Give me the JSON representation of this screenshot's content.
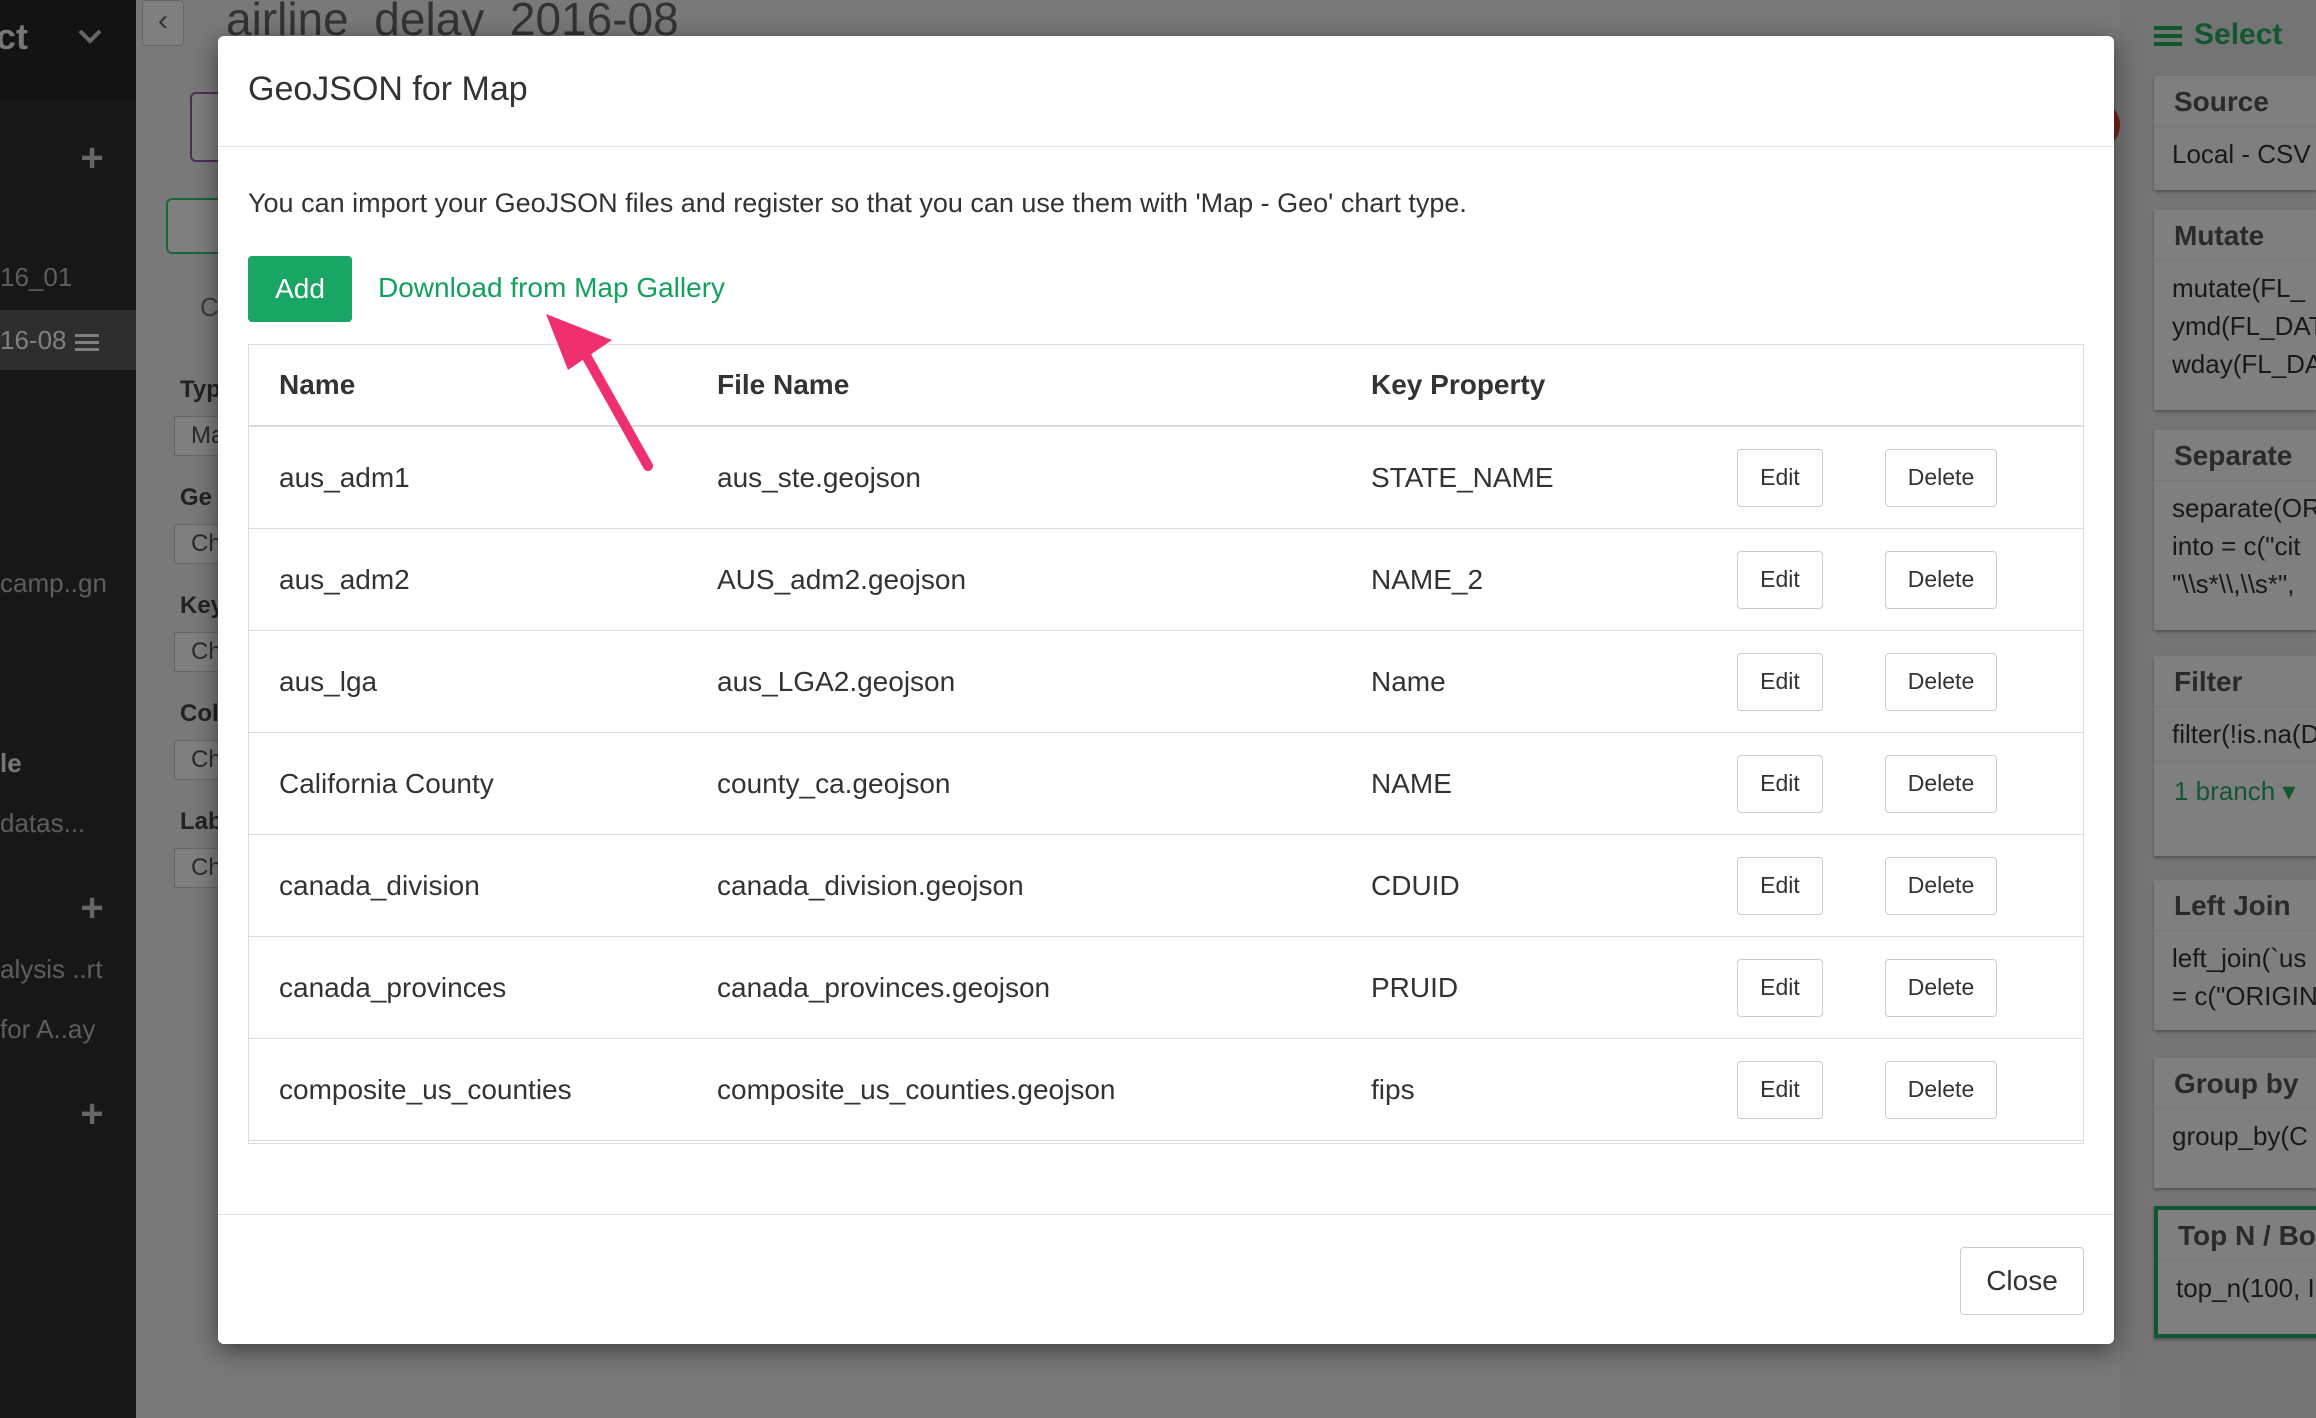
{
  "sidebar": {
    "project_title": "ct",
    "items": [
      {
        "label": "16_01"
      },
      {
        "label": "16-08"
      },
      {
        "label": "camp..gn"
      },
      {
        "label": "le"
      },
      {
        "label": "datas..."
      },
      {
        "label": "alysis ..rt"
      },
      {
        "label": "for A..ay"
      }
    ],
    "plus": "+"
  },
  "main": {
    "title": "airline_delay_2016-08",
    "back_glyph": "‹",
    "fields": [
      {
        "label": "Typ",
        "value": "Ma"
      },
      {
        "label": "Ge",
        "value": "Ch"
      },
      {
        "label": "Key",
        "value": "Ch"
      },
      {
        "label": "Col",
        "value": "Ch"
      },
      {
        "label": "Lab",
        "value": "Ch"
      }
    ],
    "tab_letter": "C"
  },
  "right_panel": {
    "select_label": "Select",
    "steps": [
      {
        "title": "Source",
        "body": [
          "Local - CSV"
        ]
      },
      {
        "title": "Mutate",
        "body": [
          "mutate(FL_",
          "ymd(FL_DAT",
          "wday(FL_DA"
        ]
      },
      {
        "title": "Separate",
        "body": [
          "separate(OR",
          "into = c(\"cit",
          "\"\\\\s*\\\\,\\\\s*\","
        ]
      },
      {
        "title": "Filter",
        "body": [
          "filter(!is.na(D"
        ],
        "branch": "1 branch ▾"
      },
      {
        "title": "Left Join",
        "body": [
          "left_join(`us",
          "= c(\"ORIGIN"
        ]
      },
      {
        "title": "Group by",
        "body": [
          "group_by(C"
        ]
      },
      {
        "title": "Top N / Bo",
        "body": [
          "top_n(100, I"
        ]
      }
    ]
  },
  "modal": {
    "title": "GeoJSON for Map",
    "intro": "You can import your GeoJSON files and register so that you can use them with 'Map - Geo' chart type.",
    "add_label": "Add",
    "gallery_link": "Download from Map Gallery",
    "columns": [
      "Name",
      "File Name",
      "Key Property"
    ],
    "rows": [
      {
        "name": "aus_adm1",
        "file": "aus_ste.geojson",
        "key": "STATE_NAME"
      },
      {
        "name": "aus_adm2",
        "file": "AUS_adm2.geojson",
        "key": "NAME_2"
      },
      {
        "name": "aus_lga",
        "file": "aus_LGA2.geojson",
        "key": "Name"
      },
      {
        "name": "California County",
        "file": "county_ca.geojson",
        "key": "NAME"
      },
      {
        "name": "canada_division",
        "file": "canada_division.geojson",
        "key": "CDUID"
      },
      {
        "name": "canada_provinces",
        "file": "canada_provinces.geojson",
        "key": "PRUID"
      },
      {
        "name": "composite_us_counties",
        "file": "composite_us_counties.geojson",
        "key": "fips"
      }
    ],
    "edit_label": "Edit",
    "delete_label": "Delete",
    "close_label": "Close"
  },
  "colors": {
    "accent_green": "#19a664",
    "link_green": "#14a05e",
    "arrow_pink": "#f0306e"
  }
}
